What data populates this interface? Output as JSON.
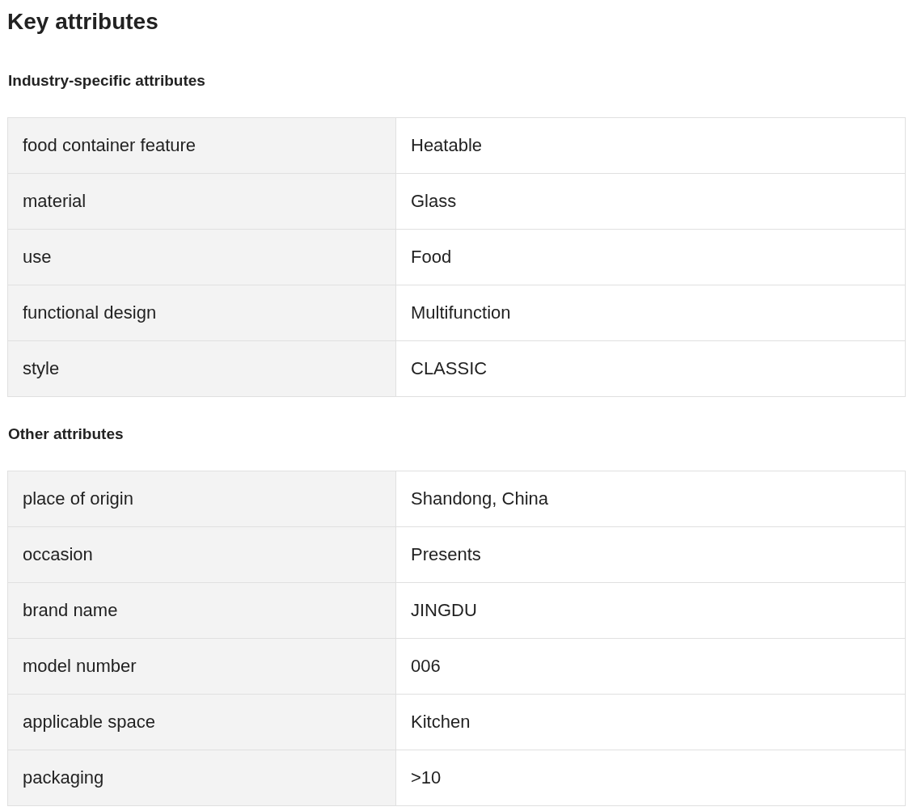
{
  "title": "Key attributes",
  "sections": [
    {
      "heading": "Industry-specific attributes",
      "rows": [
        {
          "name": "food container feature",
          "value": "Heatable"
        },
        {
          "name": "material",
          "value": "Glass"
        },
        {
          "name": "use",
          "value": "Food"
        },
        {
          "name": "functional design",
          "value": "Multifunction"
        },
        {
          "name": "style",
          "value": "CLASSIC"
        }
      ]
    },
    {
      "heading": "Other attributes",
      "rows": [
        {
          "name": "place of origin",
          "value": "Shandong, China"
        },
        {
          "name": "occasion",
          "value": "Presents"
        },
        {
          "name": "brand name",
          "value": "JINGDU"
        },
        {
          "name": "model number",
          "value": "006"
        },
        {
          "name": "applicable space",
          "value": "Kitchen"
        },
        {
          "name": "packaging",
          "value": ">10"
        }
      ]
    }
  ]
}
